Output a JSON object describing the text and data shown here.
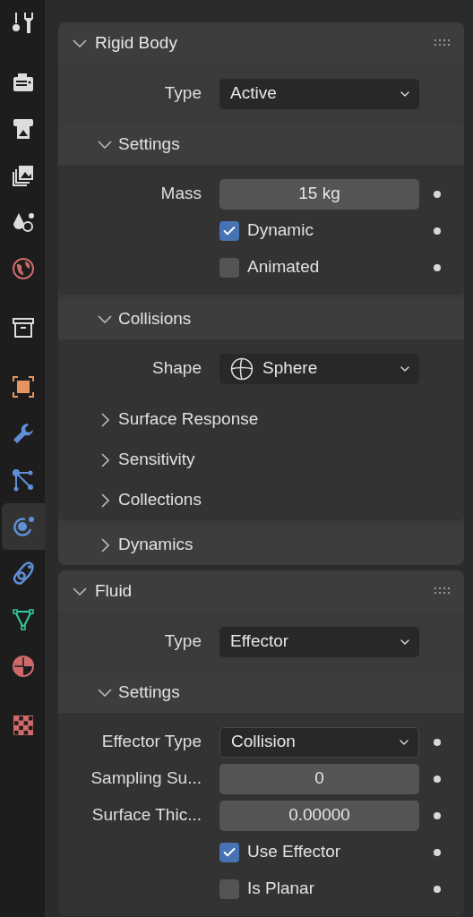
{
  "sidebar": {
    "groups": [
      [
        {
          "kind": "tool",
          "selected": false
        }
      ],
      [
        {
          "kind": "render",
          "selected": false
        },
        {
          "kind": "output",
          "selected": false
        },
        {
          "kind": "view_layer",
          "selected": false
        },
        {
          "kind": "scene",
          "selected": false
        },
        {
          "kind": "world",
          "selected": false
        }
      ],
      [
        {
          "kind": "collection",
          "selected": false
        }
      ],
      [
        {
          "kind": "object",
          "selected": false
        },
        {
          "kind": "modifier",
          "selected": false
        },
        {
          "kind": "particles",
          "selected": false
        },
        {
          "kind": "physics",
          "selected": true
        },
        {
          "kind": "constraint",
          "selected": false
        },
        {
          "kind": "data",
          "selected": false
        },
        {
          "kind": "material",
          "selected": false
        }
      ],
      [
        {
          "kind": "texture",
          "selected": false
        }
      ]
    ]
  },
  "panels": [
    {
      "title": "Rigid Body",
      "expanded": true,
      "items": [
        {
          "kind": "dropdown",
          "label": "Type",
          "value": "Active"
        },
        {
          "kind": "subpanel",
          "title": "Settings",
          "expanded": true,
          "items": [
            {
              "kind": "number",
              "label": "Mass",
              "value": "15 kg",
              "keyframe": true
            },
            {
              "kind": "checkbox",
              "label": "Dynamic",
              "checked": true,
              "keyframe": true
            },
            {
              "kind": "checkbox",
              "label": "Animated",
              "checked": false,
              "keyframe": true
            }
          ]
        },
        {
          "kind": "subpanel",
          "title": "Collisions",
          "expanded": true,
          "items": [
            {
              "kind": "dropdown",
              "label": "Shape",
              "value": "Sphere",
              "icon": true
            },
            {
              "kind": "subpanel",
              "title": "Surface Response",
              "expanded": false
            },
            {
              "kind": "subpanel",
              "title": "Sensitivity",
              "expanded": false
            },
            {
              "kind": "subpanel",
              "title": "Collections",
              "expanded": false
            }
          ]
        },
        {
          "kind": "subpanel",
          "title": "Dynamics",
          "expanded": false
        }
      ]
    },
    {
      "title": "Fluid",
      "expanded": true,
      "items": [
        {
          "kind": "dropdown",
          "label": "Type",
          "value": "Effector"
        },
        {
          "kind": "subpanel",
          "title": "Settings",
          "expanded": true,
          "items": [
            {
              "kind": "dropdown",
              "label": "Effector Type",
              "value": "Collision",
              "outlined": true,
              "keyframe": true
            },
            {
              "kind": "number",
              "label": "Sampling Su...",
              "value": "0",
              "keyframe": true
            },
            {
              "kind": "number",
              "label": "Surface Thic...",
              "value": "0.00000",
              "keyframe": true
            },
            {
              "kind": "checkbox",
              "label": "Use Effector",
              "checked": true,
              "keyframe": true
            },
            {
              "kind": "checkbox",
              "label": "Is Planar",
              "checked": false,
              "keyframe": true
            }
          ]
        }
      ]
    }
  ]
}
